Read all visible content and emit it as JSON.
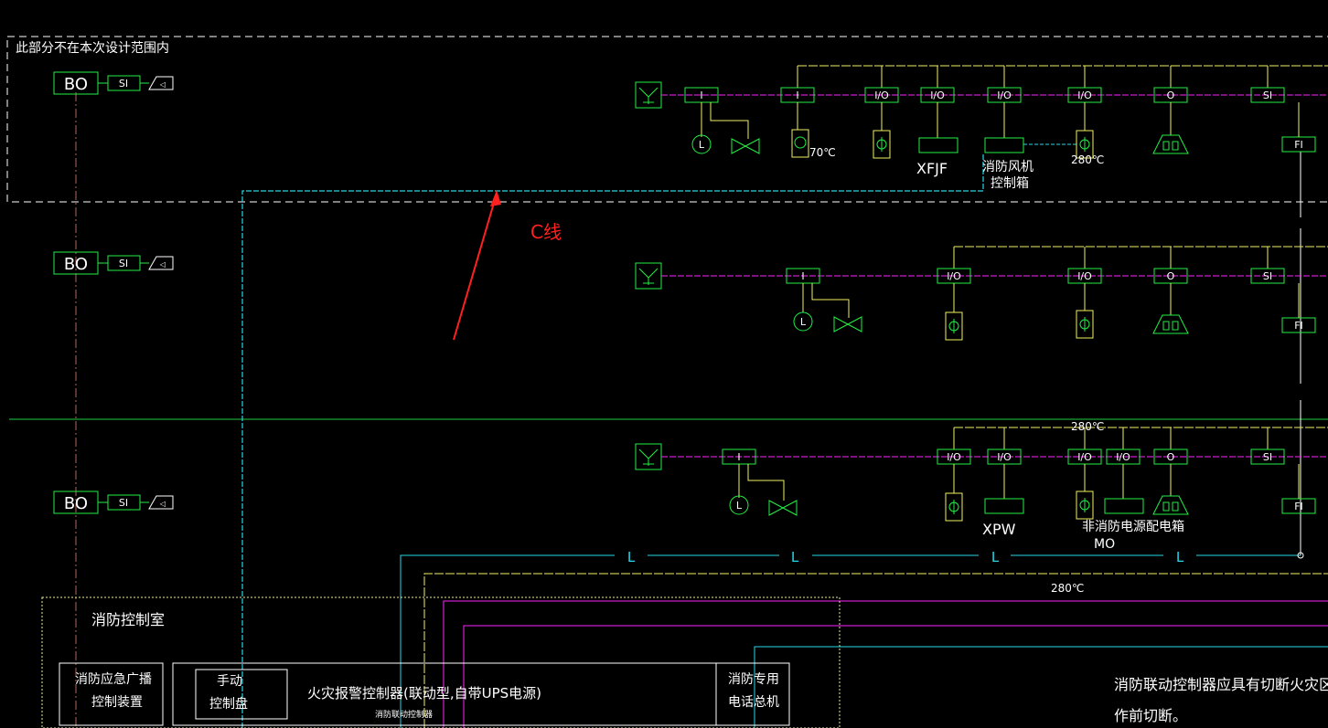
{
  "labels": {
    "excluded_scope": "此部分不在本次设计范围内",
    "c_line": "C线",
    "control_room": "消防控制室",
    "temp_70": "70℃",
    "temp_280_a": "280℃",
    "temp_280_b": "280℃",
    "temp_280_c": "280℃",
    "xfjf": "XFJF",
    "fan_box_1": "消防风机",
    "fan_box_2": "控制箱",
    "xpw": "XPW",
    "nonfire_box": "非消防电源配电箱",
    "mo": "MO",
    "note_1": "消防联动控制器应具有切断火灾区域及相",
    "note_2": "作前切断。"
  },
  "tags": {
    "bo": "BO",
    "si": "SI",
    "i": "I",
    "io": "I/O",
    "o": "O",
    "fi": "FI",
    "l": "L"
  },
  "equipment": {
    "broadcast_1": "消防应急广播",
    "broadcast_2": "控制装置",
    "manual_1": "手动",
    "manual_2": "控制盘",
    "fire_alarm_controller": "火灾报警控制器(联动型,自带UPS电源)",
    "phone_1": "消防专用",
    "phone_2": "电话总机",
    "sub_caption": "消防联动控制器"
  },
  "colors": {
    "background": "#000000",
    "device_green": "#22ee44",
    "bus_magenta": "#ff22ff",
    "bus_yellow": "#f0f060",
    "bus_cyan": "#22d8e8",
    "annotation_red": "#ff2020",
    "frame_white": "#ffffff",
    "guide_green": "#22cc44"
  }
}
